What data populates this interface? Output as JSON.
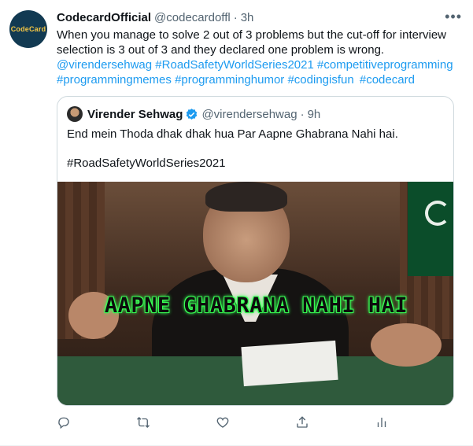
{
  "tweet": {
    "avatar_text": "CodeCard",
    "author_name": "CodecardOfficial",
    "author_handle": "@codecardoffl",
    "separator": "·",
    "time": "3h",
    "more_icon": "more-horizontal-icon",
    "text": "When you manage to solve 2 out of 3 problems but the cut-off for interview selection is 3 out of 3 and they declared one problem is wrong.",
    "tags": [
      "@virendersehwag",
      "#RoadSafetyWorldSeries2021",
      "#competitiveprogramming",
      "#programmingmemes",
      "#programminghumor",
      "#codingisfun",
      "#codecard"
    ]
  },
  "quote": {
    "author_name": "Virender Sehwag",
    "author_handle": "@virendersehwag",
    "separator": "·",
    "time": "9h",
    "text": "End mein Thoda dhak dhak hua Par Aapne Ghabrana Nahi hai.",
    "hashtag": "#RoadSafetyWorldSeries2021",
    "media_caption": "AAPNE GHABRANA NAHI HAI"
  },
  "actions": {
    "reply_icon": "reply-icon",
    "retweet_icon": "retweet-icon",
    "like_icon": "like-icon",
    "share_icon": "share-icon",
    "analytics_icon": "analytics-icon"
  },
  "colors": {
    "link": "#1d9bf0",
    "secondary_text": "#536471",
    "verified": "#1d9bf0"
  }
}
